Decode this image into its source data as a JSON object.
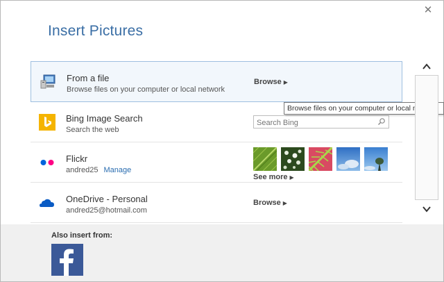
{
  "dialog": {
    "title": "Insert Pictures",
    "close_glyph": "✕"
  },
  "sources": {
    "file": {
      "name": "From a file",
      "sub": "Browse files on your computer or local network",
      "action": "Browse",
      "icon": "computer-icon"
    },
    "bing": {
      "name": "Bing Image Search",
      "sub": "Search the web",
      "search_placeholder": "Search Bing",
      "icon": "bing-icon",
      "icon_color": "#f5b400"
    },
    "flickr": {
      "name": "Flickr",
      "user": "andred25",
      "manage": "Manage",
      "see_more": "See more",
      "icon": "flickr-icon",
      "dot_colors": [
        "#0063dc",
        "#ff0084"
      ]
    },
    "onedrive": {
      "name": "OneDrive - Personal",
      "sub": "andred25@hotmail.com",
      "action": "Browse",
      "icon": "onedrive-icon",
      "icon_color": "#0a5bc4"
    }
  },
  "tooltip": "Browse files on your computer or local network",
  "footer": {
    "also_insert": "Also insert from:",
    "facebook_glyph": "f"
  },
  "colors": {
    "title": "#3a6ea5",
    "selected_row_border": "#9ebfe0",
    "footer_bg": "#f0f0f0",
    "facebook": "#3b5998"
  }
}
